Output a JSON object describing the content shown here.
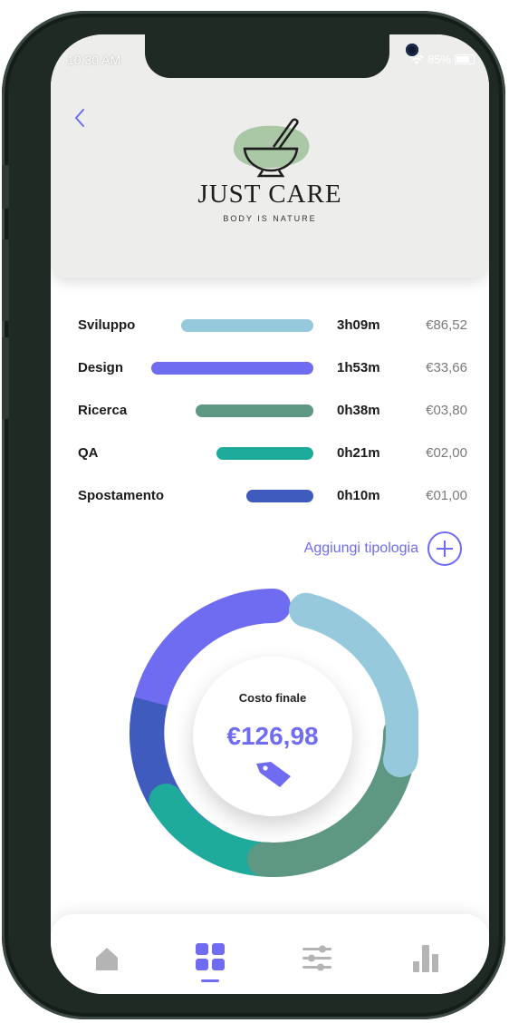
{
  "status": {
    "time": "10:30 AM",
    "battery": "85%"
  },
  "brand": {
    "name": "JUST CARE",
    "tagline": "BODY IS NATURE"
  },
  "rows": [
    {
      "label": "Sviluppo",
      "time": "3h09m",
      "cost": "€86,52",
      "color": "#97c9dc"
    },
    {
      "label": "Design",
      "time": "1h53m",
      "cost": "€33,66",
      "color": "#6f6cf2"
    },
    {
      "label": "Ricerca",
      "time": "0h38m",
      "cost": "€03,80",
      "color": "#5e9883"
    },
    {
      "label": "QA",
      "time": "0h21m",
      "cost": "€02,00",
      "color": "#1fab9c"
    },
    {
      "label": "Spostamento",
      "time": "0h10m",
      "cost": "€01,00",
      "color": "#3f5bbd"
    }
  ],
  "add_label": "Aggiungi tipologia",
  "summary": {
    "title": "Costo finale",
    "value": "€126,98"
  },
  "nav": [
    "home-icon",
    "grid-icon",
    "sliders-icon",
    "bar-chart-icon"
  ],
  "colors": {
    "accent": "#6f6cf2"
  }
}
